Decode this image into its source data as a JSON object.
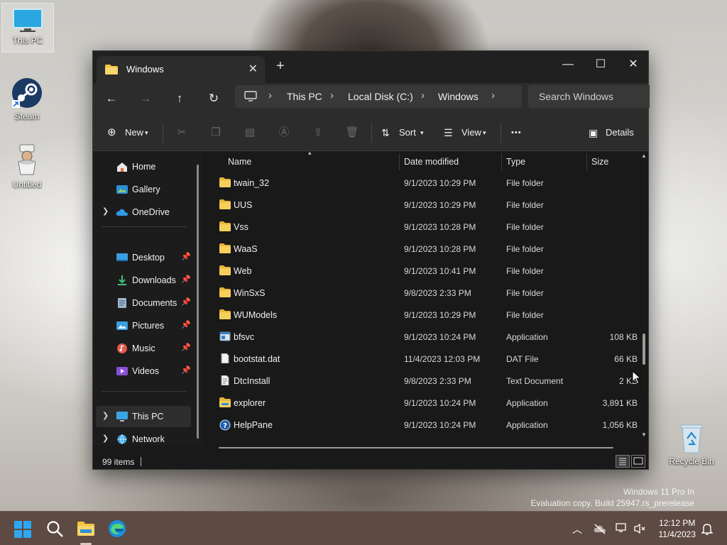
{
  "desktop": {
    "icons": [
      {
        "label": "This PC"
      },
      {
        "label": "Steam"
      },
      {
        "label": "Untitled"
      },
      {
        "label": "Recycle Bin"
      }
    ],
    "watermark": {
      "line1": "Windows 11 Pro In",
      "line2": "Evaluation copy. Build 25947.rs_prerelease"
    }
  },
  "window": {
    "tab_title": "Windows",
    "controls": {
      "minimize": "—",
      "maximize": "☐",
      "close": "✕"
    },
    "breadcrumb": [
      "This PC",
      "Local Disk (C:)",
      "Windows"
    ],
    "search_placeholder": "Search Windows",
    "toolbar": {
      "new_label": "New",
      "sort_label": "Sort",
      "view_label": "View",
      "more_label": "•••",
      "details_label": "Details"
    },
    "nav": {
      "items": [
        {
          "label": "Home"
        },
        {
          "label": "Gallery"
        },
        {
          "label": "OneDrive"
        },
        {
          "label": "Desktop"
        },
        {
          "label": "Downloads"
        },
        {
          "label": "Documents"
        },
        {
          "label": "Pictures"
        },
        {
          "label": "Music"
        },
        {
          "label": "Videos"
        },
        {
          "label": "This PC"
        },
        {
          "label": "Network"
        }
      ]
    },
    "columns": {
      "name": "Name",
      "date": "Date modified",
      "type": "Type",
      "size": "Size"
    },
    "files": [
      {
        "name": "twain_32",
        "date": "9/1/2023 10:29 PM",
        "type": "File folder",
        "size": "",
        "icon": "folder-icon"
      },
      {
        "name": "UUS",
        "date": "9/1/2023 10:29 PM",
        "type": "File folder",
        "size": "",
        "icon": "folder-icon"
      },
      {
        "name": "Vss",
        "date": "9/1/2023 10:28 PM",
        "type": "File folder",
        "size": "",
        "icon": "folder-icon"
      },
      {
        "name": "WaaS",
        "date": "9/1/2023 10:28 PM",
        "type": "File folder",
        "size": "",
        "icon": "folder-icon"
      },
      {
        "name": "Web",
        "date": "9/1/2023 10:41 PM",
        "type": "File folder",
        "size": "",
        "icon": "folder-icon"
      },
      {
        "name": "WinSxS",
        "date": "9/8/2023 2:33 PM",
        "type": "File folder",
        "size": "",
        "icon": "folder-icon"
      },
      {
        "name": "WUModels",
        "date": "9/1/2023 10:29 PM",
        "type": "File folder",
        "size": "",
        "icon": "folder-icon"
      },
      {
        "name": "bfsvc",
        "date": "9/1/2023 10:24 PM",
        "type": "Application",
        "size": "108 KB",
        "icon": "application-icon"
      },
      {
        "name": "bootstat.dat",
        "date": "11/4/2023 12:03 PM",
        "type": "DAT File",
        "size": "66 KB",
        "icon": "file-icon"
      },
      {
        "name": "DtcInstall",
        "date": "9/8/2023 2:33 PM",
        "type": "Text Document",
        "size": "2 KB",
        "icon": "text-document-icon"
      },
      {
        "name": "explorer",
        "date": "9/1/2023 10:24 PM",
        "type": "Application",
        "size": "3,891 KB",
        "icon": "explorer-icon"
      },
      {
        "name": "HelpPane",
        "date": "9/1/2023 10:24 PM",
        "type": "Application",
        "size": "1,056 KB",
        "icon": "help-icon"
      }
    ],
    "status": {
      "items_count": "99 items"
    },
    "scroll_position": 0.72
  },
  "taskbar": {
    "clock_time": "12:12 PM",
    "clock_date": "11/4/2023"
  },
  "colors": {
    "window_bg": "#191919",
    "chrome_bg": "#2c2c2c",
    "folder_yellow": "#f4c542",
    "accent_blue": "#4cc2ff",
    "taskbar_bg": "#5d4a43"
  }
}
